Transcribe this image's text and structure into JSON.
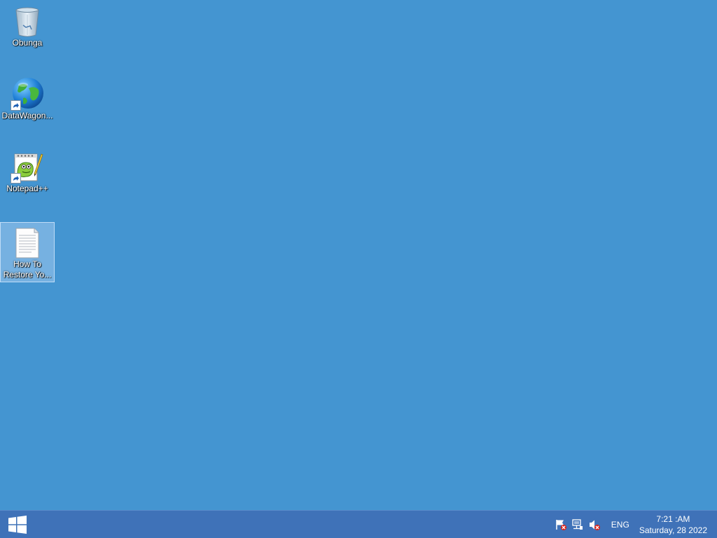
{
  "desktop": {
    "background_color": "#4495d1",
    "icons": [
      {
        "label": "Obunga",
        "icon": "recycle-bin-icon"
      },
      {
        "label": "DataWagon...",
        "icon": "globe-icon",
        "shortcut": true
      },
      {
        "label": "Notepad++",
        "icon": "notepad-plus-plus-icon",
        "shortcut": true
      },
      {
        "label": "How To Restore Yo...",
        "icon": "text-document-icon",
        "selected": true
      }
    ]
  },
  "taskbar": {
    "color": "#3f72b8",
    "start_icon": "windows-logo-icon",
    "tray": {
      "icons": [
        "action-center-flag-icon",
        "network-icon",
        "volume-muted-icon"
      ],
      "language": "ENG",
      "time": "7:21 :AM",
      "date": "Saturday, 28 2022"
    }
  }
}
